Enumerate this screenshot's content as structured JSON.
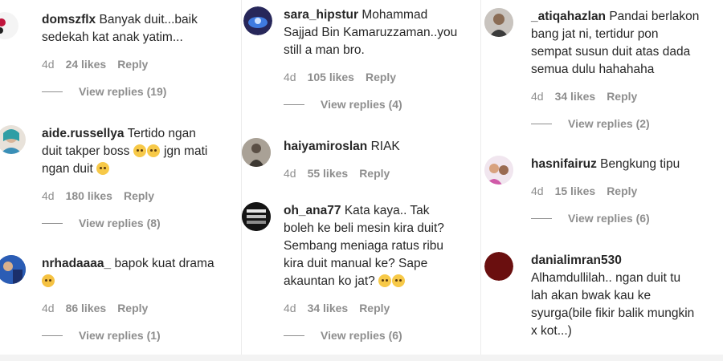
{
  "columns": [
    {
      "comments": [
        {
          "username": "domszflx",
          "text": "Banyak duit...baik\nsedekah kat anak yatim...",
          "time": "4d",
          "likes": "24 likes",
          "reply": "Reply",
          "view_replies": "View replies (19)"
        },
        {
          "username": "aide.russellya",
          "text_parts": [
            "Tertido ngan\nduit takper boss ",
            "jgn mati\nngan duit "
          ],
          "emoji_counts": [
            2,
            1
          ],
          "time": "4d",
          "likes": "180 likes",
          "reply": "Reply",
          "view_replies": "View replies (8)"
        },
        {
          "username": "nrhadaaaa_",
          "text": "bapok kuat drama\n",
          "time": "4d",
          "likes": "86 likes",
          "reply": "Reply",
          "view_replies": "View replies (1)"
        }
      ]
    },
    {
      "comments": [
        {
          "username": "sara_hipstur",
          "text": "Mohammad\nSajjad Bin Kamaruzzaman..you\nstill a man bro.",
          "time": "4d",
          "likes": "105 likes",
          "reply": "Reply",
          "view_replies": "View replies (4)"
        },
        {
          "username": "haiyamiroslan",
          "text": "RIAK",
          "time": "4d",
          "likes": "55 likes",
          "reply": "Reply"
        },
        {
          "username": "oh_ana77",
          "text": "Kata kaya.. Tak\nboleh ke beli mesin kira duit?\nSembang meniaga ratus ribu\nkira duit manual ke? Sape\nakauntan ko jat? ",
          "time": "4d",
          "likes": "34 likes",
          "reply": "Reply",
          "view_replies": "View replies (6)"
        }
      ]
    },
    {
      "comments": [
        {
          "username": "_atiqahazlan",
          "text": "Pandai berlakon\nbang jat ni, tertidur pon\nsempat susun duit atas dada\nsemua dulu hahahaha",
          "time": "4d",
          "likes": "34 likes",
          "reply": "Reply",
          "view_replies": "View replies (2)"
        },
        {
          "username": "hasnifairuz",
          "text": "Bengkung tipu",
          "time": "4d",
          "likes": "15 likes",
          "reply": "Reply",
          "view_replies": "View replies (6)"
        },
        {
          "username": "danialimran530",
          "text": "\nAlhamdullilah.. ngan duit tu\nlah akan bwak kau ke\nsyurga(bile fikir balik mungkin\nx kot...)"
        }
      ]
    }
  ]
}
